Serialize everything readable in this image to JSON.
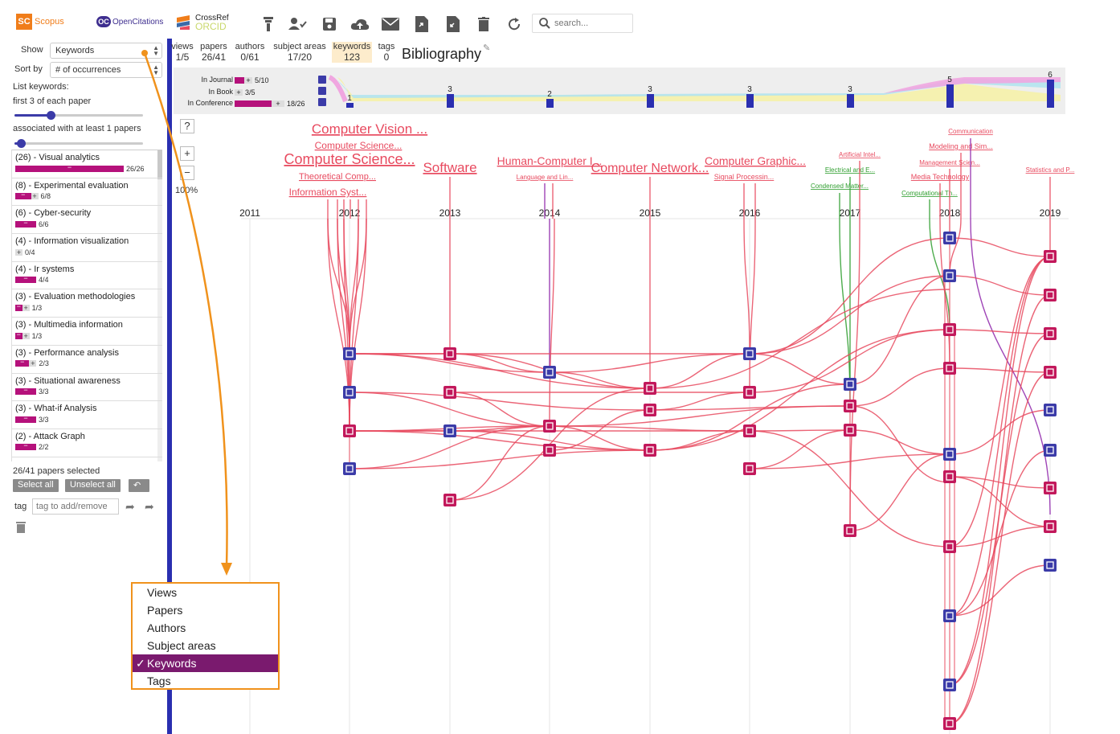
{
  "sources": {
    "scopus": {
      "logo": "SC",
      "label": "Scopus"
    },
    "opencitations": {
      "logo": "OC",
      "label": "OpenCitations"
    },
    "crossref": {
      "label": "CrossRef",
      "orcid": "ORCID"
    }
  },
  "toolbar": {
    "icons": [
      "filter-icon",
      "add-authors-icon",
      "save-icon",
      "cloud-upload-icon",
      "email-icon",
      "export-file-icon",
      "import-file-icon",
      "trash-icon",
      "refresh-icon"
    ],
    "search_placeholder": "search..."
  },
  "left": {
    "show_label": "Show",
    "show_value": "Keywords",
    "sortby_label": "Sort by",
    "sortby_value": "# of occurrences",
    "list_keywords_label": "List keywords:",
    "first_label": "first 3 of each paper",
    "assoc_label": "associated with at least 1 papers",
    "slider1_fraction": 0.28,
    "slider2_fraction": 0.05,
    "keywords": [
      {
        "name": "(26) - Visual analytics",
        "count": "26/26",
        "fill": 1.0
      },
      {
        "name": "(8) - Experimental evaluation",
        "count": "6/8",
        "fill": 0.75
      },
      {
        "name": "(6) - Cyber-security",
        "count": "6/6",
        "fill": 1.0
      },
      {
        "name": "(4) - Information visualization",
        "count": "0/4",
        "fill": 0.0
      },
      {
        "name": "(4) - Ir systems",
        "count": "4/4",
        "fill": 1.0
      },
      {
        "name": "(3) - Evaluation methodologies",
        "count": "1/3",
        "fill": 0.33
      },
      {
        "name": "(3) - Multimedia information",
        "count": "1/3",
        "fill": 0.33
      },
      {
        "name": "(3) - Performance analysis",
        "count": "2/3",
        "fill": 0.67
      },
      {
        "name": "(3) - Situational awareness",
        "count": "3/3",
        "fill": 1.0
      },
      {
        "name": "(3) - What-if Analysis",
        "count": "3/3",
        "fill": 1.0
      },
      {
        "name": "(2) - Attack Graph",
        "count": "2/2",
        "fill": 1.0
      }
    ],
    "papers_selected": "26/41 papers selected",
    "select_all": "Select all",
    "unselect_all": "Unselect all",
    "tag_label": "tag",
    "tag_placeholder": "tag to add/remove"
  },
  "stats": [
    {
      "label": "views",
      "value": "1/5",
      "active": false
    },
    {
      "label": "papers",
      "value": "26/41",
      "active": false
    },
    {
      "label": "authors",
      "value": "0/61",
      "active": false
    },
    {
      "label": "subject areas",
      "value": "17/20",
      "active": false
    },
    {
      "label": "keywords",
      "value": "123",
      "active": true
    },
    {
      "label": "tags",
      "value": "0",
      "active": false
    }
  ],
  "title": "Bibliography",
  "strip": {
    "rows": [
      {
        "label": "In Journal",
        "count": "5/10"
      },
      {
        "label": "In Book",
        "count": "3/5"
      },
      {
        "label": "In Conference",
        "count": "18/26"
      }
    ],
    "year_counts": [
      "1",
      "3",
      "2",
      "3",
      "3",
      "3",
      "5",
      "6"
    ]
  },
  "graph": {
    "help": "?",
    "zoom_in": "+",
    "zoom_out": "−",
    "zoom": "100%",
    "years": [
      "2011",
      "2012",
      "2013",
      "2014",
      "2015",
      "2016",
      "2017",
      "2018",
      "2019"
    ],
    "subject_labels": [
      {
        "text": "Computer Vision ...",
        "size": "large"
      },
      {
        "text": "Computer Science...",
        "size": "medium"
      },
      {
        "text": "Computer Science...",
        "size": "xlarge"
      },
      {
        "text": "Theoretical Comp...",
        "size": "small"
      },
      {
        "text": "Information Syst...",
        "size": "medium"
      },
      {
        "text": "Software",
        "size": "large"
      },
      {
        "text": "Human-Computer I...",
        "size": "medium"
      },
      {
        "text": "Language and Lin...",
        "size": "tiny"
      },
      {
        "text": "Computer Network...",
        "size": "large"
      },
      {
        "text": "Computer Graphic...",
        "size": "medium"
      },
      {
        "text": "Signal Processin...",
        "size": "tiny"
      },
      {
        "text": "Artificial Intel...",
        "size": "tiny"
      },
      {
        "text": "Electrical and E...",
        "size": "tiny"
      },
      {
        "text": "Condensed Matter...",
        "size": "tiny"
      },
      {
        "text": "Communication",
        "size": "tiny"
      },
      {
        "text": "Modeling and Sim...",
        "size": "tiny"
      },
      {
        "text": "Management Scien...",
        "size": "tiny"
      },
      {
        "text": "Media Technology",
        "size": "tiny"
      },
      {
        "text": "Computational Th...",
        "size": "tiny"
      },
      {
        "text": "Statistics and P...",
        "size": "tiny"
      }
    ],
    "colors": {
      "link": "#e84a5f",
      "journal": "#3b3ba8",
      "conference": "#c2185b",
      "green": "#2e9e2e",
      "purple": "#8e24aa"
    }
  },
  "dropdown": {
    "options": [
      "Views",
      "Papers",
      "Authors",
      "Subject areas",
      "Keywords",
      "Tags"
    ],
    "selected": "Keywords",
    "check": "✓"
  }
}
